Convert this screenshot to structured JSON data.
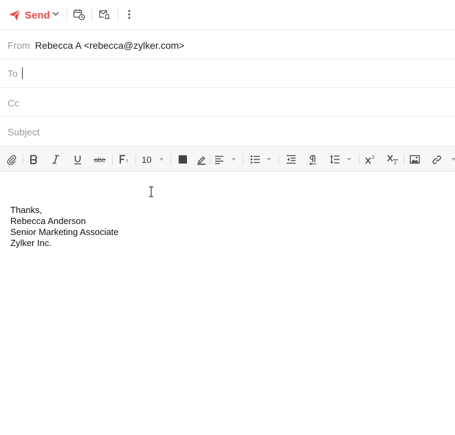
{
  "toolbar": {
    "send_label": "Send",
    "icons": [
      "send-icon",
      "chevron-down-icon",
      "schedule-icon",
      "reminder-icon",
      "more-options-icon"
    ]
  },
  "fields": {
    "from_label": "From",
    "from_value": "Rebecca A <rebecca@zylker.com>",
    "to_label": "To",
    "to_value": "",
    "cc_label": "Cc",
    "cc_value": "",
    "subject_label": "Subject",
    "subject_value": ""
  },
  "format": {
    "font_size": "10"
  },
  "signature": {
    "line1": "Thanks,",
    "line2": "Rebecca Anderson",
    "line3": "Senior Marketing Associate",
    "line4": "Zylker Inc."
  },
  "colors": {
    "send_accent": "#e84a4a",
    "label_gray": "#9a9a9a",
    "format_bar_bg": "#f7f7f7"
  }
}
